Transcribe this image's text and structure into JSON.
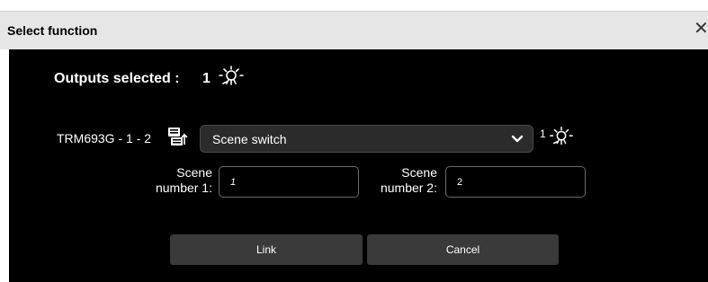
{
  "dialog": {
    "title": "Select function",
    "close_glyph": "✕"
  },
  "outputs": {
    "label": "Outputs selected :",
    "count": "1",
    "icon": "light-icon"
  },
  "row": {
    "device_label": "TRM693G - 1 - 2",
    "device_icon": "device-link-icon",
    "function_value": "Scene switch",
    "output_count": "1",
    "output_icon": "light-icon"
  },
  "scene": {
    "label1": "Scene number 1:",
    "value1": "1",
    "label2": "Scene number 2:",
    "value2": "2"
  },
  "buttons": {
    "link": "Link",
    "cancel": "Cancel"
  },
  "colors": {
    "dialog_background": "#000000",
    "titlebar": "#e6e6e6",
    "button": "#3a3a3a",
    "select": "#2b2b2b"
  }
}
